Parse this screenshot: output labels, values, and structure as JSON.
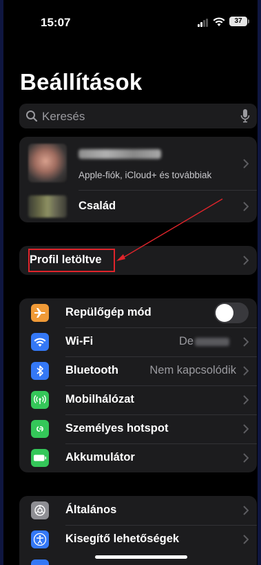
{
  "status": {
    "time": "15:07",
    "battery": "37"
  },
  "title": "Beállítások",
  "search": {
    "placeholder": "Keresés"
  },
  "account": {
    "subtitle": "Apple-fiók, iCloud+ és továbbiak",
    "family_label": "Család"
  },
  "profile": {
    "label": "Profil letöltve"
  },
  "connectivity": [
    {
      "label": "Repülőgép mód",
      "icon": "airplane-icon",
      "color": "#f09a37"
    },
    {
      "label": "Wi-Fi",
      "value": "De",
      "icon": "wifi-icon",
      "color": "#3478f6"
    },
    {
      "label": "Bluetooth",
      "value": "Nem kapcsolódik",
      "icon": "bluetooth-icon",
      "color": "#3478f6"
    },
    {
      "label": "Mobilhálózat",
      "icon": "cellular-icon",
      "color": "#34c759"
    },
    {
      "label": "Személyes hotspot",
      "icon": "hotspot-icon",
      "color": "#34c759"
    },
    {
      "label": "Akkumulátor",
      "icon": "battery-icon",
      "color": "#34c759"
    }
  ],
  "general": [
    {
      "label": "Általános",
      "icon": "gear-icon",
      "color": "#8e8e93"
    },
    {
      "label": "Kisegítő lehetőségek",
      "icon": "accessibility-icon",
      "color": "#3478f6"
    }
  ],
  "annotation": {
    "color": "#e0242b"
  }
}
